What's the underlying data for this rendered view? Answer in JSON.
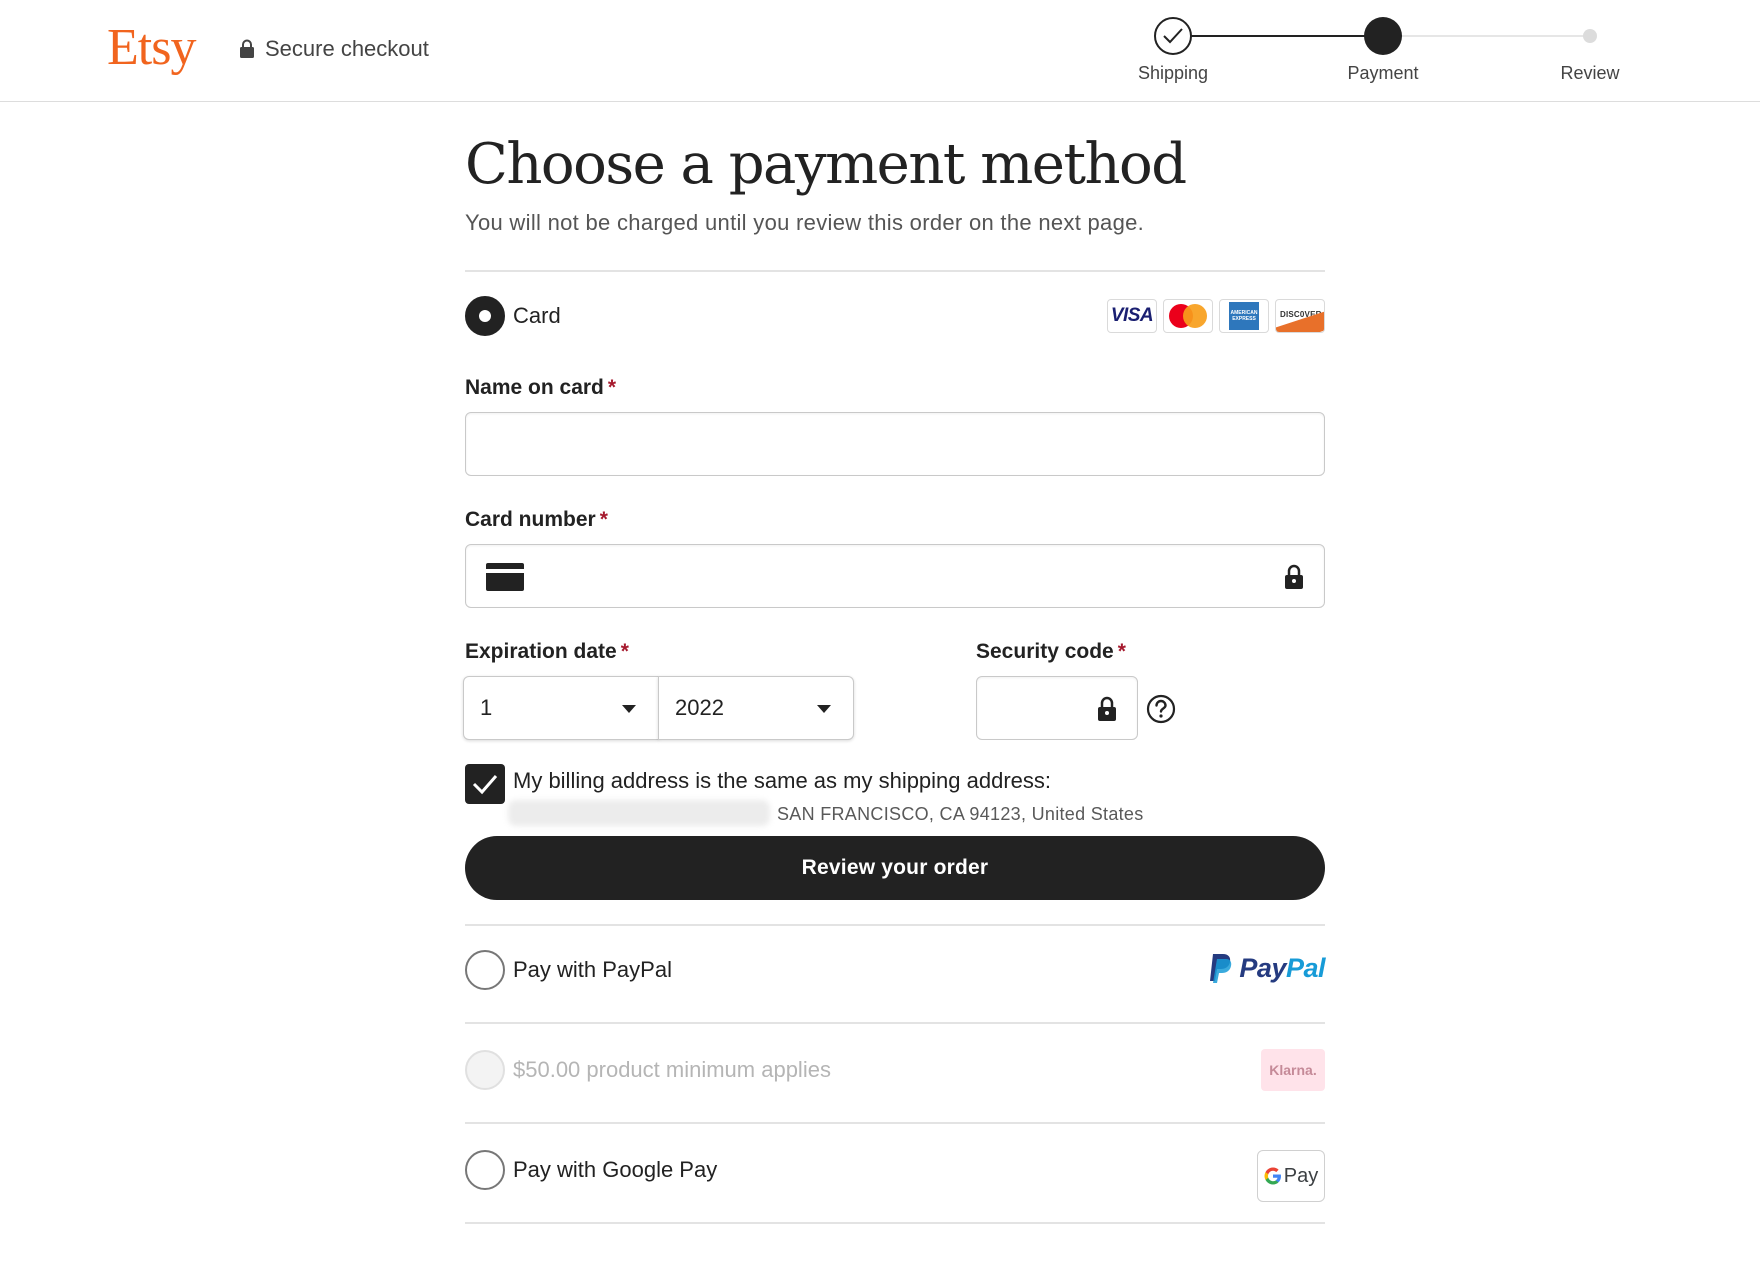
{
  "header": {
    "logo": "Etsy",
    "secure_label": "Secure checkout",
    "steps": [
      {
        "label": "Shipping",
        "state": "done"
      },
      {
        "label": "Payment",
        "state": "current"
      },
      {
        "label": "Review",
        "state": "upcoming"
      }
    ]
  },
  "page": {
    "title": "Choose a payment method",
    "subtitle": "You will not be charged until you review this order on the next page."
  },
  "card_option": {
    "label": "Card",
    "selected": true,
    "brands": [
      "VISA",
      "Mastercard",
      "American Express",
      "DISCOVER"
    ],
    "visa_text": "VISA",
    "amex_text": "AMERICAN EXPRESS",
    "discover_text": "DISC0VER"
  },
  "form": {
    "name_label": "Name on card",
    "name_value": "",
    "card_number_label": "Card number",
    "card_number_value": "",
    "expiration_label": "Expiration date",
    "exp_month": "1",
    "exp_year": "2022",
    "security_label": "Security code",
    "security_value": "",
    "required_mark": "*"
  },
  "billing": {
    "checked": true,
    "label": "My billing address is the same as my shipping address:",
    "address": "SAN FRANCISCO, CA 94123, United States"
  },
  "review_button": "Review your order",
  "other_options": {
    "paypal_label": "Pay with PayPal",
    "paypal_logo_a": "Pay",
    "paypal_logo_b": "Pal",
    "klarna_label": "$50.00 product minimum applies",
    "klarna_logo": "Klarna.",
    "gpay_label": "Pay with Google Pay",
    "gpay_logo": "Pay"
  },
  "colors": {
    "brand": "#F1641E",
    "primary": "#222222",
    "required": "#a61a2e",
    "divider": "#e3e3e3"
  }
}
